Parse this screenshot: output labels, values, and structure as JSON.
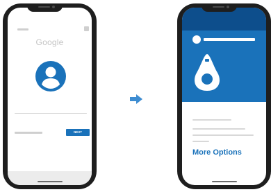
{
  "colors": {
    "brand_blue": "#1a72ba",
    "dark_blue": "#0d4e8c",
    "phone_frame": "#1e1e1e",
    "placeholder_gray": "#cfcfcf"
  },
  "left_phone": {
    "logo_text": "Google",
    "next_button_label": "NEXT",
    "avatar_icon": "user-avatar-icon"
  },
  "transition": {
    "arrow_icon": "arrow-right-icon"
  },
  "right_phone": {
    "key_icon": "security-key-icon",
    "more_options_label": "More Options"
  }
}
